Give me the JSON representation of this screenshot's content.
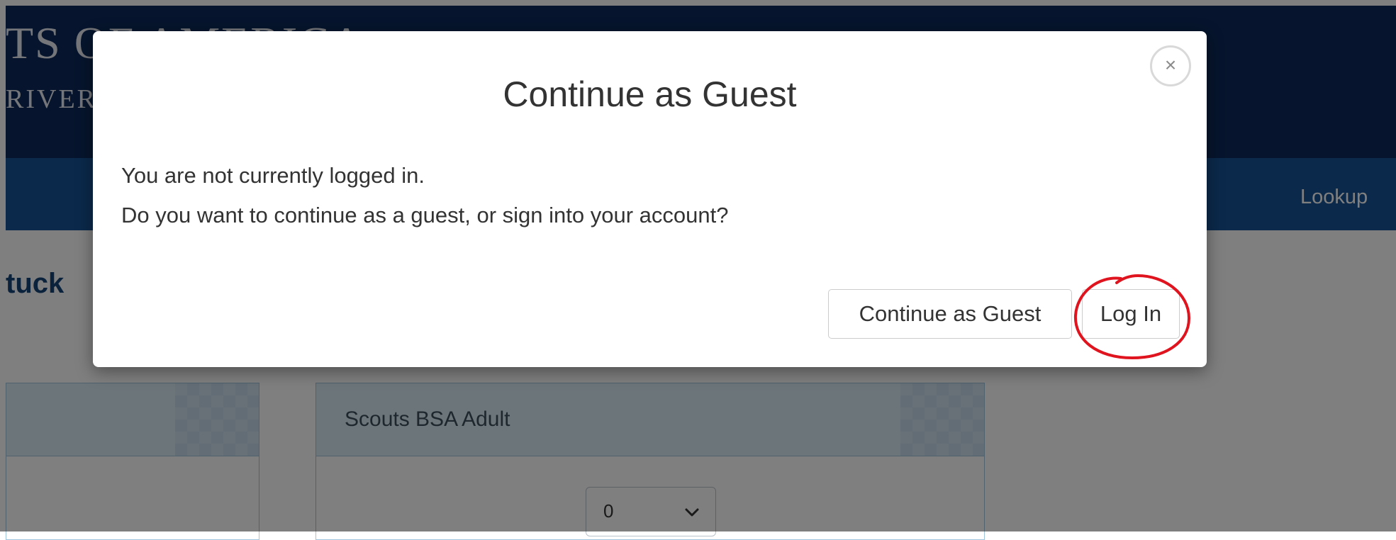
{
  "header": {
    "brand_line1": "TS OF AMERICA",
    "brand_line2": "RIVER",
    "nav_lookup": "Lookup"
  },
  "page": {
    "heading": "tuck"
  },
  "cards": [
    {
      "title": ""
    },
    {
      "title": "Scouts BSA Adult",
      "quantity": "0"
    }
  ],
  "modal": {
    "title": "Continue as Guest",
    "close_symbol": "×",
    "message_line1": "You are not currently logged in.",
    "message_line2": "Do you want to continue as a guest, or sign into your account?",
    "guest_button": "Continue as Guest",
    "login_button": "Log In"
  },
  "colors": {
    "banner": "#0d2a5a",
    "nav": "#165396",
    "heading": "#17447a",
    "card_header": "#d9eaf5",
    "annotation": "#e0141e"
  },
  "icons": [
    "close-icon",
    "chevron-down-icon"
  ]
}
